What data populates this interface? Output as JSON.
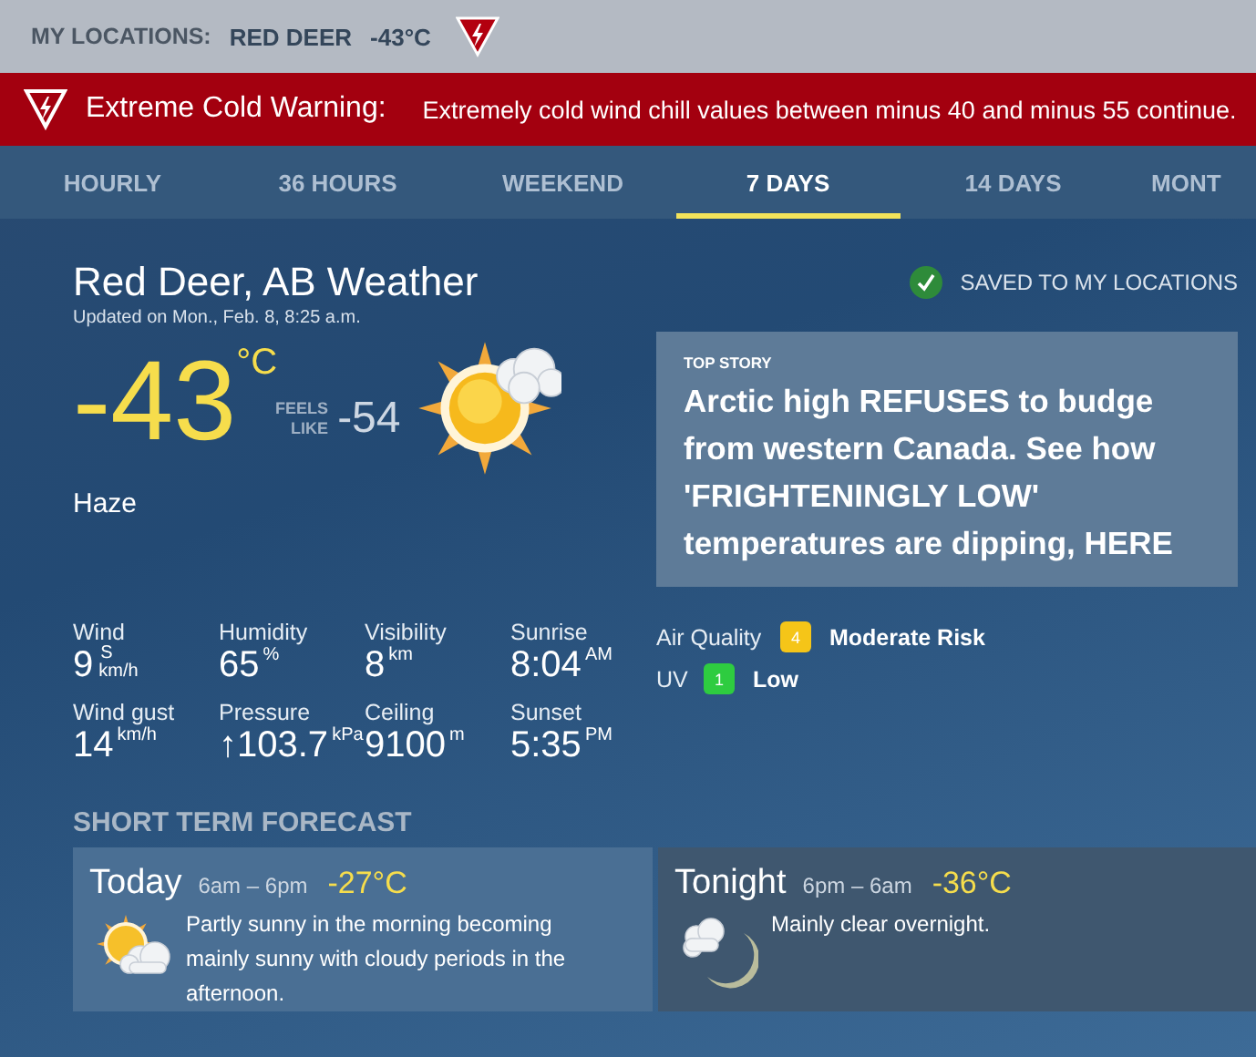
{
  "top_bar": {
    "label": "MY LOCATIONS:",
    "location": "RED DEER",
    "temperature": "-43°C"
  },
  "alert": {
    "title": "Extreme Cold Warning:",
    "message": "Extremely cold wind chill values between minus 40 and minus 55 continue."
  },
  "tabs": [
    {
      "label": "HOURLY",
      "selected": false
    },
    {
      "label": "36 HOURS",
      "selected": false
    },
    {
      "label": "WEEKEND",
      "selected": false
    },
    {
      "label": "7 DAYS",
      "selected": true
    },
    {
      "label": "14 DAYS",
      "selected": false
    },
    {
      "label": "MONT",
      "selected": false
    }
  ],
  "current": {
    "title": "Red Deer, AB Weather",
    "updated": "Updated on Mon., Feb. 8, 8:25 a.m.",
    "temperature": "-43",
    "unit": "°C",
    "feels_like_label": "FEELS LIKE",
    "feels_like": "-54",
    "condition": "Haze"
  },
  "saved": {
    "label": "SAVED TO MY LOCATIONS",
    "checked": true
  },
  "top_story": {
    "label": "TOP STORY",
    "headline": "Arctic high REFUSES to budge from western Canada. See how 'FRIGHTENINGLY LOW' temperatures are dipping, HERE"
  },
  "details": [
    {
      "label": "Wind",
      "value": "9",
      "direction": "S",
      "unit": "km/h"
    },
    {
      "label": "Humidity",
      "value": "65",
      "unit": "%"
    },
    {
      "label": "Visibility",
      "value": "8",
      "unit": "km"
    },
    {
      "label": "Sunrise",
      "value": "8:04",
      "unit": "AM"
    },
    {
      "label": "Wind gust",
      "value": "14",
      "unit": "km/h"
    },
    {
      "label": "Pressure",
      "value": "↑103.7",
      "unit": "kPa"
    },
    {
      "label": "Ceiling",
      "value": "9100",
      "unit": "m"
    },
    {
      "label": "Sunset",
      "value": "5:35",
      "unit": "PM"
    }
  ],
  "indices": [
    {
      "label": "Air Quality",
      "value": "4",
      "color": "#f5c518",
      "rating": "Moderate Risk"
    },
    {
      "label": "UV",
      "value": "1",
      "color": "#2ecc40",
      "rating": "Low"
    }
  ],
  "short_term": {
    "heading": "SHORT TERM FORECAST",
    "periods": [
      {
        "kind": "day",
        "name": "Today",
        "hours": "6am – 6pm",
        "temperature": "-27°C",
        "text": "Partly sunny in the morning becoming mainly sunny with cloudy periods in the afternoon."
      },
      {
        "kind": "night",
        "name": "Tonight",
        "hours": "6pm – 6am",
        "temperature": "-36°C",
        "text": "Mainly clear overnight."
      }
    ]
  }
}
